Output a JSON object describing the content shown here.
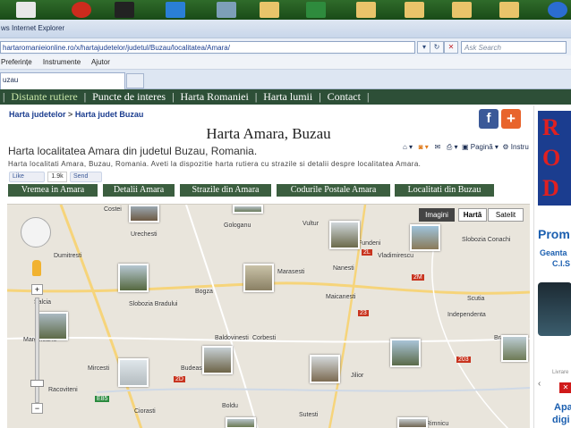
{
  "browser": {
    "title": "ws Internet Explorer",
    "url": "hartaromanieionline.ro/x/hartajudetelor/judetul/Buzau/localitatea/Amara/",
    "search_placeholder": "Ask Search",
    "menu": [
      "Preferințe",
      "Instrumente",
      "Ajutor"
    ],
    "tab_title": "uzau",
    "page_menu": "Pagină",
    "tools_menu": "Instru"
  },
  "site_nav": {
    "items": [
      "Distante rutiere",
      "Puncte de interes",
      "Harta Romaniei",
      "Harta lumii",
      "Contact"
    ],
    "separator": "|"
  },
  "breadcrumb": {
    "first": "Harta judetelor",
    "sep": ">",
    "second": "Harta judet Buzau"
  },
  "social": {
    "fb": "f",
    "plus": "+"
  },
  "page": {
    "title": "Harta Amara, Buzau",
    "subtitle": "Harta localitatea Amara din judetul Buzau, Romania.",
    "description": "Harta localitati Amara, Buzau, Romania. Aveti la dispozitie harta rutiera cu strazile si detalii despre localitatea Amara.",
    "like_label": "Like",
    "like_count": "1.9k",
    "send_label": "Send"
  },
  "content_tabs": [
    "Vremea in Amara",
    "Detalii Amara",
    "Strazile din Amara",
    "Codurile Postale Amara",
    "Localitati din Buzau"
  ],
  "map": {
    "type_buttons": [
      "Imagini",
      "Hartă",
      "Satelit"
    ],
    "zoom_plus": "+",
    "zoom_minus": "−",
    "labels": [
      "Costei",
      "Gologanu",
      "Vultur",
      "Fundeni",
      "Slobozia Conachi",
      "Dumitresti",
      "Urechesti",
      "Vladimirescu",
      "Nanesti",
      "Bogza",
      "Maicanesti",
      "Salcia",
      "Slobozia Bradului",
      "Independenta",
      "Scutia",
      "Margineanu",
      "Baldovinesti",
      "Corbesti",
      "Bra",
      "Racoviteni",
      "Jilior",
      "Boldu",
      "Rimnicu",
      "Ciorasti",
      "Sutesti",
      "Mircesti",
      "Budeasa",
      "Marasesti"
    ],
    "route_numbers": [
      "23",
      "2L",
      "E85",
      "2D",
      "2M",
      "203"
    ]
  },
  "sidebar": {
    "banner_letters": [
      "R",
      "O",
      "D"
    ],
    "promo": "Prom",
    "geanta": "Geanta",
    "cis": "C.I.S",
    "livrare": "Livrare",
    "chevron": "‹",
    "close": "✕",
    "apa": "Apa",
    "dig": "digi"
  },
  "colors": {
    "site_nav_bg": "#2d4f37",
    "tab_bg": "#3b5e3f",
    "link_blue": "#1b3d8f",
    "fb_blue": "#3b5998",
    "plus_orange": "#e8642c"
  }
}
